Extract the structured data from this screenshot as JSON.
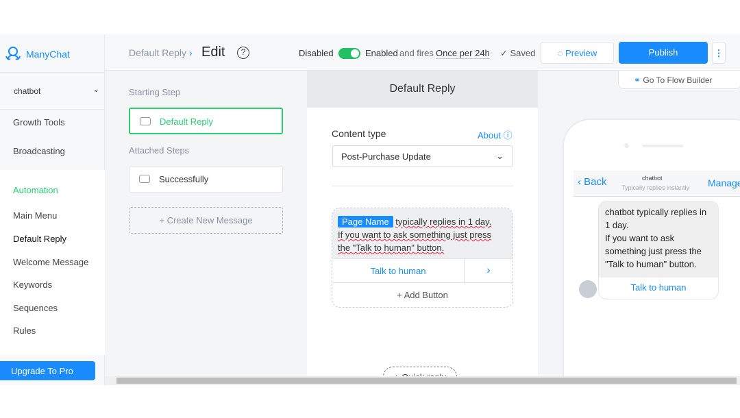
{
  "sidebar": {
    "brand": "ManyChat",
    "bot_name": "chatbot",
    "items": [
      {
        "label": "Growth Tools"
      },
      {
        "label": "Broadcasting"
      },
      {
        "label": "Automation"
      },
      {
        "label": "Main Menu"
      },
      {
        "label": "Default Reply"
      },
      {
        "label": "Welcome Message"
      },
      {
        "label": "Keywords"
      },
      {
        "label": "Sequences"
      },
      {
        "label": "Rules"
      }
    ],
    "upgrade_label": "Upgrade To Pro"
  },
  "header": {
    "breadcrumb": "Default Reply",
    "title": "Edit",
    "help": "?",
    "disabled_label": "Disabled",
    "enabled_label": "Enabled",
    "fires_label": "and fires",
    "frequency": "Once per 24h",
    "toggle_on": true,
    "saved_label": "✓ Saved",
    "preview_label": "Preview",
    "publish_label": "Publish",
    "more": "⋮",
    "flow_builder_label": "Go To Flow Builder"
  },
  "steps": {
    "starting_label": "Starting Step",
    "starting_step": "Default Reply",
    "attached_label": "Attached Steps",
    "attached": [
      "Successfully"
    ],
    "create_label": "+ Create New Message"
  },
  "editor": {
    "title": "Default Reply",
    "content_type_label": "Content type",
    "about_label": "About",
    "content_type_value": "Post-Purchase Update",
    "page_name_tag": "Page Name",
    "message_line1": "typically replies in 1 day.",
    "message_line2": "If you want to ask something just press",
    "message_line3": "the \"Talk to human\" button.",
    "button_label": "Talk to human",
    "add_button_label": "+ Add Button",
    "quick_reply_label": "+ Quick reply"
  },
  "preview": {
    "back_label": "Back",
    "bot_name": "chatbot",
    "status": "Typically replies instantly",
    "manage_label": "Manage",
    "message": "chatbot typically replies in 1 day.\n If you want to ask something just press the \"Talk to human\" button.",
    "button_label": "Talk to human"
  },
  "colors": {
    "accent": "#1a8cff",
    "active": "#2ecc71",
    "toggle": "#21c064"
  }
}
